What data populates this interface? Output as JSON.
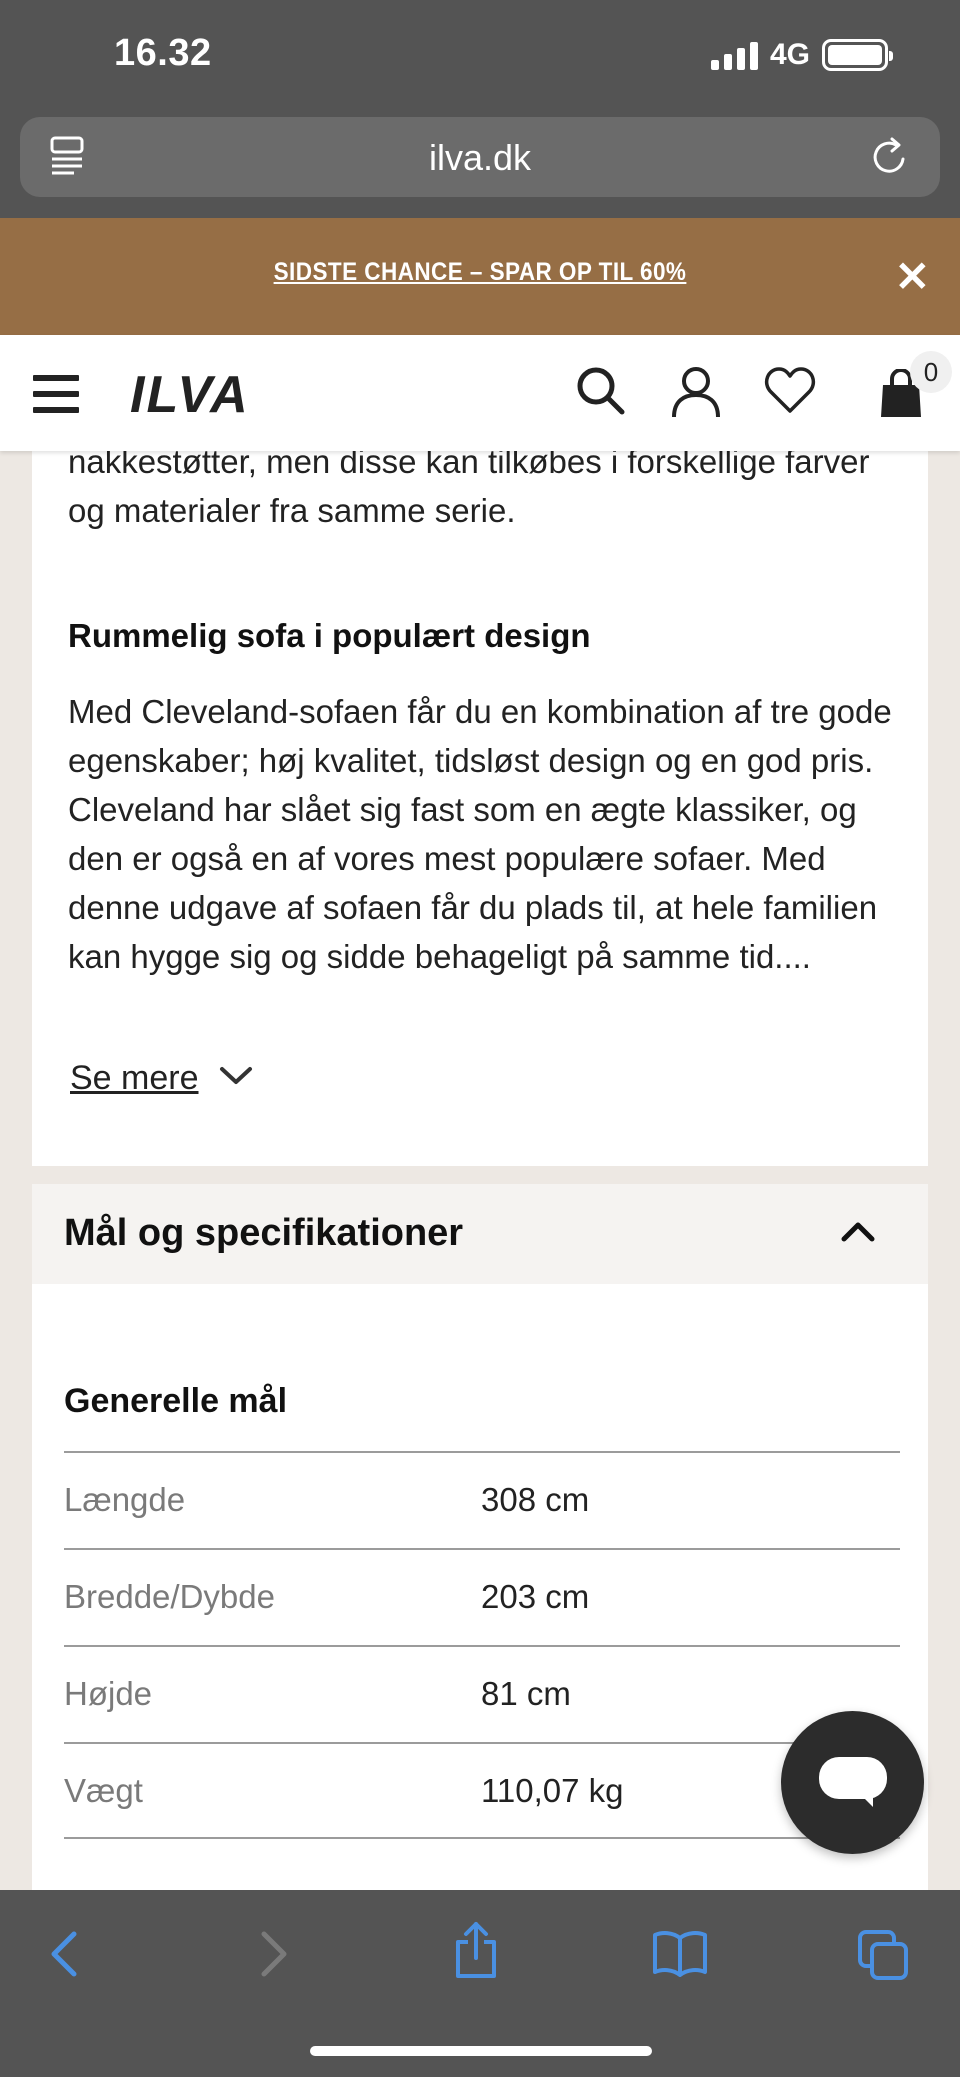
{
  "status_bar": {
    "time": "16.32",
    "network": "4G"
  },
  "browser": {
    "url": "ilva.dk"
  },
  "promo": {
    "text": "SIDSTE CHANCE – SPAR OP TIL 60%",
    "close": "✕"
  },
  "header": {
    "logo": "ILVA",
    "cart_count": "0"
  },
  "description": {
    "intro_text": "nakkestøtter, men disse kan tilkøbes i forskellige farver og materialer fra samme serie.",
    "heading": "Rummelig sofa i populært design",
    "body": "Med Cleveland-sofaen får du en kombination af tre gode egenskaber; høj kvalitet, tidsløst design og en god pris. Cleveland har slået sig fast som en ægte klassiker, og den er også en af vores mest populære sofaer. Med denne udgave af sofaen får du plads til, at hele familien kan hygge sig og sidde behageligt på samme tid....",
    "see_more": "Se mere"
  },
  "specs": {
    "title": "Mål og specifikationer",
    "subheading": "Generelle mål",
    "rows": [
      {
        "label": "Længde",
        "value": "308 cm"
      },
      {
        "label": "Bredde/Dybde",
        "value": "203 cm"
      },
      {
        "label": "Højde",
        "value": "81 cm"
      },
      {
        "label": "Vægt",
        "value": "110,07 kg"
      }
    ]
  },
  "colors": {
    "promo_bg": "#966e45",
    "chrome_bg": "#545454",
    "toolbar_icon": "#4a90e2",
    "page_bg": "#ede8e3"
  },
  "icons": [
    "reader-icon",
    "reload-icon",
    "close-icon",
    "menu-icon",
    "search-icon",
    "account-icon",
    "wishlist-icon",
    "cart-icon",
    "chevron-down-icon",
    "chevron-up-icon",
    "chat-icon",
    "back-icon",
    "forward-icon",
    "share-icon",
    "bookmarks-icon",
    "tabs-icon"
  ]
}
